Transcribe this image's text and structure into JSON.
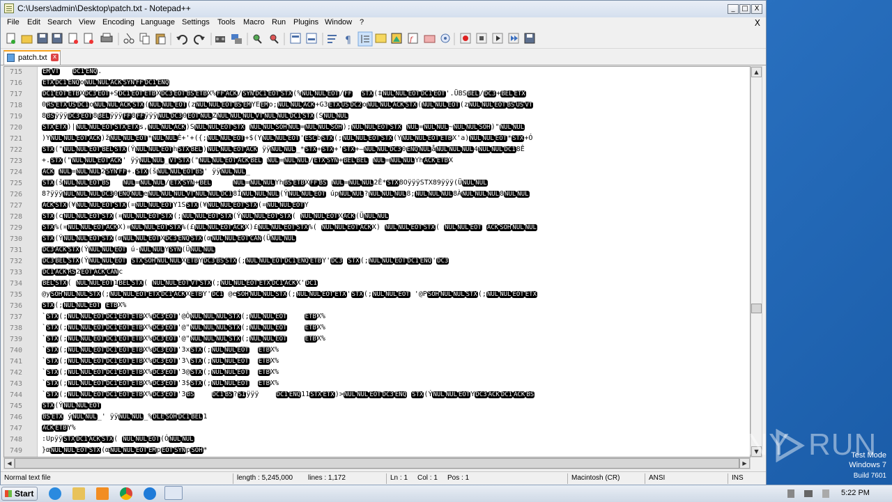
{
  "window": {
    "title": "C:\\Users\\admin\\Desktop\\patch.txt - Notepad++",
    "minimize": "_",
    "maximize": "□",
    "close": "X"
  },
  "menu": {
    "items": [
      "File",
      "Edit",
      "Search",
      "View",
      "Encoding",
      "Language",
      "Settings",
      "Tools",
      "Macro",
      "Run",
      "Plugins",
      "Window",
      "?"
    ],
    "close": "X"
  },
  "toolbar": {
    "icons": [
      "new-file-icon",
      "open-file-icon",
      "save-icon",
      "save-all-icon",
      "close-icon",
      "close-all-icon",
      "print-icon",
      "cut-icon",
      "copy-icon",
      "paste-icon",
      "undo-icon",
      "redo-icon",
      "find-icon",
      "replace-icon",
      "zoom-in-icon",
      "zoom-out-icon",
      "sync-v-icon",
      "sync-h-icon",
      "wrap-icon",
      "all-chars-icon",
      "indent-guide-icon",
      "lang-udl-icon",
      "doc-map-icon",
      "function-list-icon",
      "folder-workspace-icon",
      "monitor-icon",
      "record-macro-icon",
      "stop-macro-icon",
      "play-macro-icon",
      "run-macro-multiple-icon",
      "save-macro-icon"
    ]
  },
  "tab": {
    "name": "patch.txt",
    "close": "x"
  },
  "editor": {
    "lines": [
      {
        "n": "715",
        "t": "<EM><VT>   <DC1><ENQ>."
      },
      {
        "n": "716",
        "t": "<ETX><DC1><ENQ>o<NUL><NUL><ACK><SYN><FF><DC1><ENQ>"
      },
      {
        "n": "717",
        "t": "<DC1><EOT><ETB>X<DC3><EOT>+S<DC1><EOT><ETB>X<DC3><EOT><BS><ETB>X%<FF><ACK>/<SYN><DC1><EOT><STX>(%<NUL><NUL><EOT>/<FF>  <STX>(‡<NUL><NUL><EOT><DC1><EOT>'.ÜBS<BEL>/<DC3>+<BEL><ETX>"
      },
      {
        "n": "718",
        "t": "0<RS><ETX><US><DC1>o<NUL><NUL><ACK><STX>(<NUL><NUL><EOT>(z<NUL><NUL><EOT><BS><EM>YE<EM>o;<NUL><NUL><ACK>+G3<ETX><US><DC2>o<NUL><NUL><ACK><STX>(<NUL><NUL><EOT>(z<NUL><NUL><EOT><BS><US><VT>"
      },
      {
        "n": "719",
        "t": "8<BS>ÿÿÿ<DC3><EOT>8<BEL>ÿÿÿ<FF>8<FF>ÿÿÿ<NUL><DC3>0<EOT><NUL>Z<NUL><NUL><NUL><VT><NUL><NUL><DC1><STX>(S<NUL><NUL>"
      },
      {
        "n": "720",
        "t": "<STX><ETX>)|<NUL><NUL><EOT><STX><ETX>s,<NUL><NUL><ACK>)S<NUL><NUL><EOT><STX> <NUL><NUL><SOH><NUL>=<NUL><NUL><SOH>);<NUL><NUL><EOT><STX> <NUL>=<NUL><NUL>~<NUL><NUL><SOH>)\"<NUL><NUL>"
      },
      {
        "n": "721",
        "t": ")Y<NUL><NUL><EOT><ACK>)ž<NUL><NUL><EOT>*<NUL><NUL>È+'+({;<NUL><NUL><EOT>+$(Y<NUL><NUL><EOT>'<ESC>b<STX>(;<NUL><NUL><EOT><STX>(Y<NUL><NUL><EOT><ETB>X'a)<NUL><NUL><EOT>*<STX>+Ó"
      },
      {
        "n": "722",
        "t": "<STX>(\"<NUL><NUL><EOT><BEL><STX>(Ý<NUL><NUL><EOT>h<STX><BEL>)<NUL><NUL><EOT><ACK> ÿÿ<NUL><NUL>_*<STX>+<STX>+'<STX>+—<NUL><NUL><DC3>0<ENQ><NUL>å<NUL><NUL><NUL>4<NUL><NUL><DC1>8Ê"
      },
      {
        "n": "723",
        "t": "+.<STX>(\"<NUL><NUL><EOT><ACK>' ÿÿ<NUL><NUL>_<VT><STX>(\"<NUL><NUL><EOT><ACK><BEL> <NUL>=<NUL><NUL>/<ETX><SYN>+<BEL><BEL> <NUL>=<NUL><NUL>Yh<ACK><ETB>X"
      },
      {
        "n": "724",
        "t": "<ACK> <NUL>=<NUL><NUL>2<SYN><FF>+.<STX>(š<NUL><NUL><EOT><BS>' ÿÿ<NUL><NUL>_"
      },
      {
        "n": "725",
        "t": "<STX>(š<NUL><NUL><EOT><BS>   <NUL>=<NUL><NUL>/<ETX><SYN>+<BEL>     <NUL>=<NUL><NUL>Yh<BS><ETB>X<FF><BS> <NUL>=<NUL><NUL>2Ê*<STX>8OÿÿÿSTX89ÿÿÿ(Ü<NUL><NUL>"
      },
      {
        "n": "726",
        "t": "8?ÿÿÿ<NUL><NUL><NUL><DC3>0<ENQ><NUL>e<NUL><NUL><NUL><VT><NUL><NUL><DC1>8Í<NUL><NUL><NUL>(Ý<NUL><NUL><EOT> úp<NUL><NUL>?<NUL><NUL><NUL>8;<NUL><NUL><NUL>8À<NUL><NUL><NUL>8<NUL><NUL>"
      },
      {
        "n": "727",
        "t": "<ACK><STX>(¥<NUL><NUL><EOT><STX>(¤<NUL><NUL><EOT>Y1S<STX>(¥<NUL><NUL><EOT><STX>(¤<NUL><NUL><EOT>Y"
      },
      {
        "n": "728",
        "t": "<STX>(c<NUL><NUL><EOT><STX>(¤<NUL><NUL><EOT><STX>(;<NUL><NUL><EOT><STX>(Ý<NUL><NUL><EOT><STX>( <NUL><NUL><EOT>X<ACK>(Ü<NUL><NUL>"
      },
      {
        "n": "729",
        "t": "<STX>%(¤<NUL><NUL><EOT><ACK>X)¤<NUL><NUL><EOT><STX>%(£<NUL><NUL><EOT><ACK>X)£<NUL><NUL><EOT><STX>%( <NUL><NUL><EOT><ACK>X) <NUL><NUL><EOT><STX>( <NUL><NUL><EOT> <ACK><SOH><NUL><NUL>"
      },
      {
        "n": "730",
        "t": "<STX>(Ý<NUL><NUL><EOT><STX>(œ<NUL><NUL><EOT>X<DC3><ENQ><STX>(œ<NUL><NUL><EOT><CAN>(Ü<NUL><NUL>"
      },
      {
        "n": "731",
        "t": "<DC3><ACK><STX>(Ý<NUL><NUL><EOT> ú-<NUL><NUL>Y<SYN>(Ü<NUL><NUL>"
      },
      {
        "n": "732",
        "t": "<DC3><BEL><STX>(Ý<NUL><NUL><EOT> <STX><SOH><NUL><NUL>X<ETB>Y<DC3><BS><STX>(;<NUL><NUL><EOT><DC1><ENQ><ETB>Y'<DC3> <STX>(;<NUL><NUL><EOT><DC1><ENQ>'<DC3>"
      },
      {
        "n": "733",
        "t": "<DC1><ACK><RS>2<EOT><ACK><CAN>c"
      },
      {
        "n": "734",
        "t": "<BEL><STX>( <NUL><NUL><EOT>1<BEL><STX>( <NUL><NUL><EOT><VT><STX>(;<NUL><NUL><EOT><ETX><DC1><ACK>X'<DC1>"
      },
      {
        "n": "735",
        "t": "@y<SOH><NUL><NUL><STX>(;<NUL><NUL><EOT><ETX><DC1><ACK>X<ETB>Y'<DC1> @e<SOH><NUL><NUL><STX>(;<NUL><NUL><EOT><ETX>'<STX>(;<NUL><NUL><EOT> '@P<SOH><NUL><NUL><STX>(;<NUL><NUL><EOT><ETX>"
      },
      {
        "n": "736",
        "t": "<STX>(;<NUL><NUL><EOT> <ETB>X%"
      },
      {
        "n": "737",
        "t": "`<STX>(;<NUL><NUL><EOT><DC1><EOT><ETB>X%<DC3><EOT>'@Ò<NUL><NUL><NUL><STX>(;<NUL><NUL><EOT>    <ETB>X%"
      },
      {
        "n": "738",
        "t": "`<STX>(;<NUL><NUL><EOT><DC1><EOT><ETB>X%<DC3><EOT>'@\"<NUL><NUL><NUL><STX>(;<NUL><NUL><EOT>    <ETB>X%"
      },
      {
        "n": "739",
        "t": "`<STX>(;<NUL><NUL><EOT><DC1><EOT><ETB>X%<DC3><EOT>'@\"<NUL><NUL><NUL><STX>(;<NUL><NUL><EOT>    <ETB>X%"
      },
      {
        "n": "740",
        "t": "`<STX>(;<NUL><NUL><EOT><DC1><EOT><ETB>X%<DC3><EOT>'3x<STX>(;<NUL><NUL><EOT>  <ETB>X%"
      },
      {
        "n": "741",
        "t": "`<STX>(;<NUL><NUL><EOT><DC1><EOT><ETB>X%<DC3><EOT>'3\\<STX>(;<NUL><NUL><EOT>  <ETB>X%"
      },
      {
        "n": "742",
        "t": "`<STX>(;<NUL><NUL><EOT><DC1><EOT><ETB>X%<DC3><EOT>'3@<STX>(;<NUL><NUL><EOT>  <ETB>X%"
      },
      {
        "n": "743",
        "t": "`<STX>(;<NUL><NUL><EOT><DC1><EOT><ETB>X%<DC3><EOT>'3$<STX>(;<NUL><NUL><EOT>  <ETB>X%"
      },
      {
        "n": "744",
        "t": "`<STX>(;<NUL><NUL><EOT><DC1><EOT><ETB>X%<DC3><EOT>'3<BS>    <DC1><BS>?<SI>ÿÿÿ    <DC1><ENQ>11<STX><ETX>)><NUL><NUL><EOT><DC3><ENQ> <STX>(Ý<NUL><NUL><EOT>Y<DC3><ACK><DC1><ACK><BS>"
      },
      {
        "n": "745",
        "t": "<STX>(Ý<NUL><NUL><EOT>"
      },
      {
        "n": "746",
        "t": "<BS><ETX> ý<NUL><NUL>_' ÿÿ<NUL><NUL>_%<DLE><SOH><DC1><BEL>1"
      },
      {
        "n": "747",
        "t": "<ACK><ETB>Y%"
      },
      {
        "n": "748",
        "t": ":Upÿÿ<STX><DC1><ACK><STX>( <NUL><NUL><EOT>(Ó<NUL><NUL>"
      },
      {
        "n": "749",
        "t": "}œ<NUL><NUL><EOT><STX>(œ<NUL><NUL><EOT><EM>p<EOT><SYN>p<SOH>*"
      }
    ]
  },
  "statusbar": {
    "type": "Normal text file",
    "length": "length : 5,245,000",
    "lines": "lines : 1,172",
    "ln": "Ln : 1",
    "col": "Col : 1",
    "pos": "Pos : 1",
    "eol": "Macintosh (CR)",
    "encoding": "ANSI",
    "mode": "INS"
  },
  "taskbar": {
    "start": "Start",
    "time": "5:22 PM"
  },
  "watermark": {
    "line1": "Test Mode",
    "line2": "Windows 7",
    "line3": "Build 7601",
    "brand_left": "ANY",
    "brand_right": "RUN"
  },
  "colors": {
    "tab_accent": "#f7a21d",
    "desktop": "#2c74c4",
    "control_char_bg": "#000000"
  }
}
